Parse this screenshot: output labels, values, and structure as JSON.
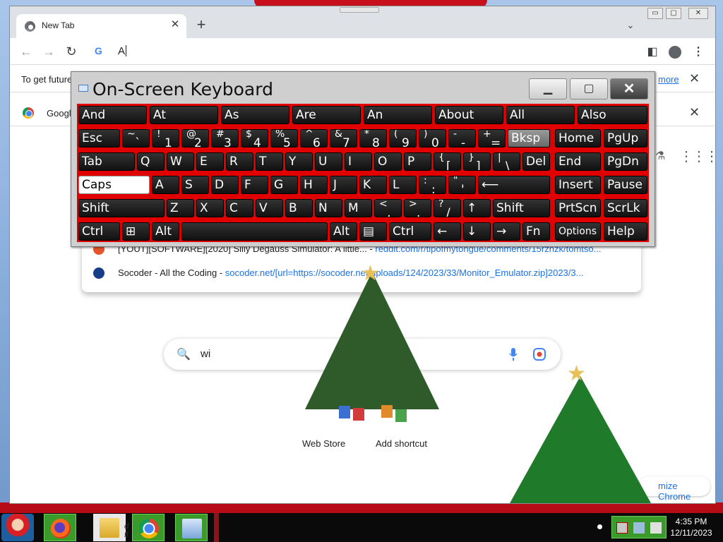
{
  "browser": {
    "tab_title": "New Tab",
    "tab_close": "✕",
    "new_tab": "+",
    "tab_search": "⌄",
    "window_min": "▭",
    "window_max": "▢",
    "window_close": "✕"
  },
  "toolbar": {
    "back": "←",
    "forward": "→",
    "reload": "↻",
    "omnibox_icon": "G",
    "omnibox_value": "A",
    "side_panel": "◧",
    "menu": "⋮"
  },
  "infobar": {
    "text": "To get future",
    "link": "more",
    "close": "✕"
  },
  "infobar2": {
    "text": "Googl",
    "close": "✕"
  },
  "suggestions": [
    {
      "title": "[YOUT][SOFTWARE][2020] Silly Degauss Simulator: A little...",
      "url": "reddit.com/r/tipofmytongue/comments/15rznzk/tomtso..."
    },
    {
      "title": "Socoder - All the Coding",
      "url": "socoder.net/[url=https://socoder.net/uploads/124/2023/33/Monitor_Emulator.zip]2023/3..."
    }
  ],
  "ntp": {
    "search_value": "wi",
    "search_icon": "🔍",
    "apps_icon": "⋮⋮⋮",
    "labs_icon": "⚗",
    "shortcuts": [
      "Web Store",
      "Add shortcut"
    ],
    "customize": "mize Chrome"
  },
  "osk": {
    "title": "On-Screen Keyboard",
    "min": "▁",
    "max": "▢",
    "close": "✕",
    "predictions": [
      "And",
      "At",
      "As",
      "Are",
      "An",
      "About",
      "All",
      "Also"
    ],
    "row1": {
      "esc": "Esc",
      "symbols": [
        {
          "up": "~",
          "dn": "`"
        },
        {
          "up": "!",
          "dn": "1"
        },
        {
          "up": "@",
          "dn": "2"
        },
        {
          "up": "#",
          "dn": "3"
        },
        {
          "up": "$",
          "dn": "4"
        },
        {
          "up": "%",
          "dn": "5"
        },
        {
          "up": "^",
          "dn": "6"
        },
        {
          "up": "&",
          "dn": "7"
        },
        {
          "up": "*",
          "dn": "8"
        },
        {
          "up": "(",
          "dn": "9"
        },
        {
          "up": ")",
          "dn": "0"
        },
        {
          "up": "-",
          "dn": "-"
        },
        {
          "up": "+",
          "dn": "="
        }
      ],
      "bksp": "Bksp",
      "home": "Home",
      "pgup": "PgUp"
    },
    "row2": {
      "tab": "Tab",
      "letters": [
        "Q",
        "W",
        "E",
        "R",
        "T",
        "Y",
        "U",
        "I",
        "O",
        "P"
      ],
      "symbols": [
        {
          "up": "{",
          "dn": "["
        },
        {
          "up": "}",
          "dn": "]"
        },
        {
          "up": "|",
          "dn": "\\"
        }
      ],
      "del": "Del",
      "end": "End",
      "pgdn": "PgDn"
    },
    "row3": {
      "caps": "Caps",
      "letters": [
        "A",
        "S",
        "D",
        "F",
        "G",
        "H",
        "J",
        "K",
        "L"
      ],
      "symbols": [
        {
          "up": ":",
          "dn": ";"
        },
        {
          "up": "\"",
          "dn": "'"
        }
      ],
      "enter": "⟵",
      "insert": "Insert",
      "pause": "Pause"
    },
    "row4": {
      "shift_left": "Shift",
      "letters": [
        "Z",
        "X",
        "C",
        "V",
        "B",
        "N",
        "M"
      ],
      "symbols": [
        {
          "up": "<",
          "dn": ","
        },
        {
          "up": ">",
          "dn": "."
        },
        {
          "up": "?",
          "dn": "/"
        }
      ],
      "up_arrow": "↑",
      "shift_right": "Shift",
      "prtscn": "PrtScn",
      "scrlk": "ScrLk"
    },
    "row5": {
      "ctrl_left": "Ctrl",
      "win": "⊞",
      "alt_left": "Alt",
      "space": "",
      "alt_right": "Alt",
      "menu": "▤",
      "ctrl_right": "Ctrl",
      "left_arrow": "←",
      "down_arrow": "↓",
      "right_arrow": "→",
      "fn": "Fn",
      "options": "Options",
      "help": "Help"
    }
  },
  "taskbar": {
    "explorer_label": "d fi",
    "time": "4:35 PM",
    "date": "12/11/2023"
  }
}
